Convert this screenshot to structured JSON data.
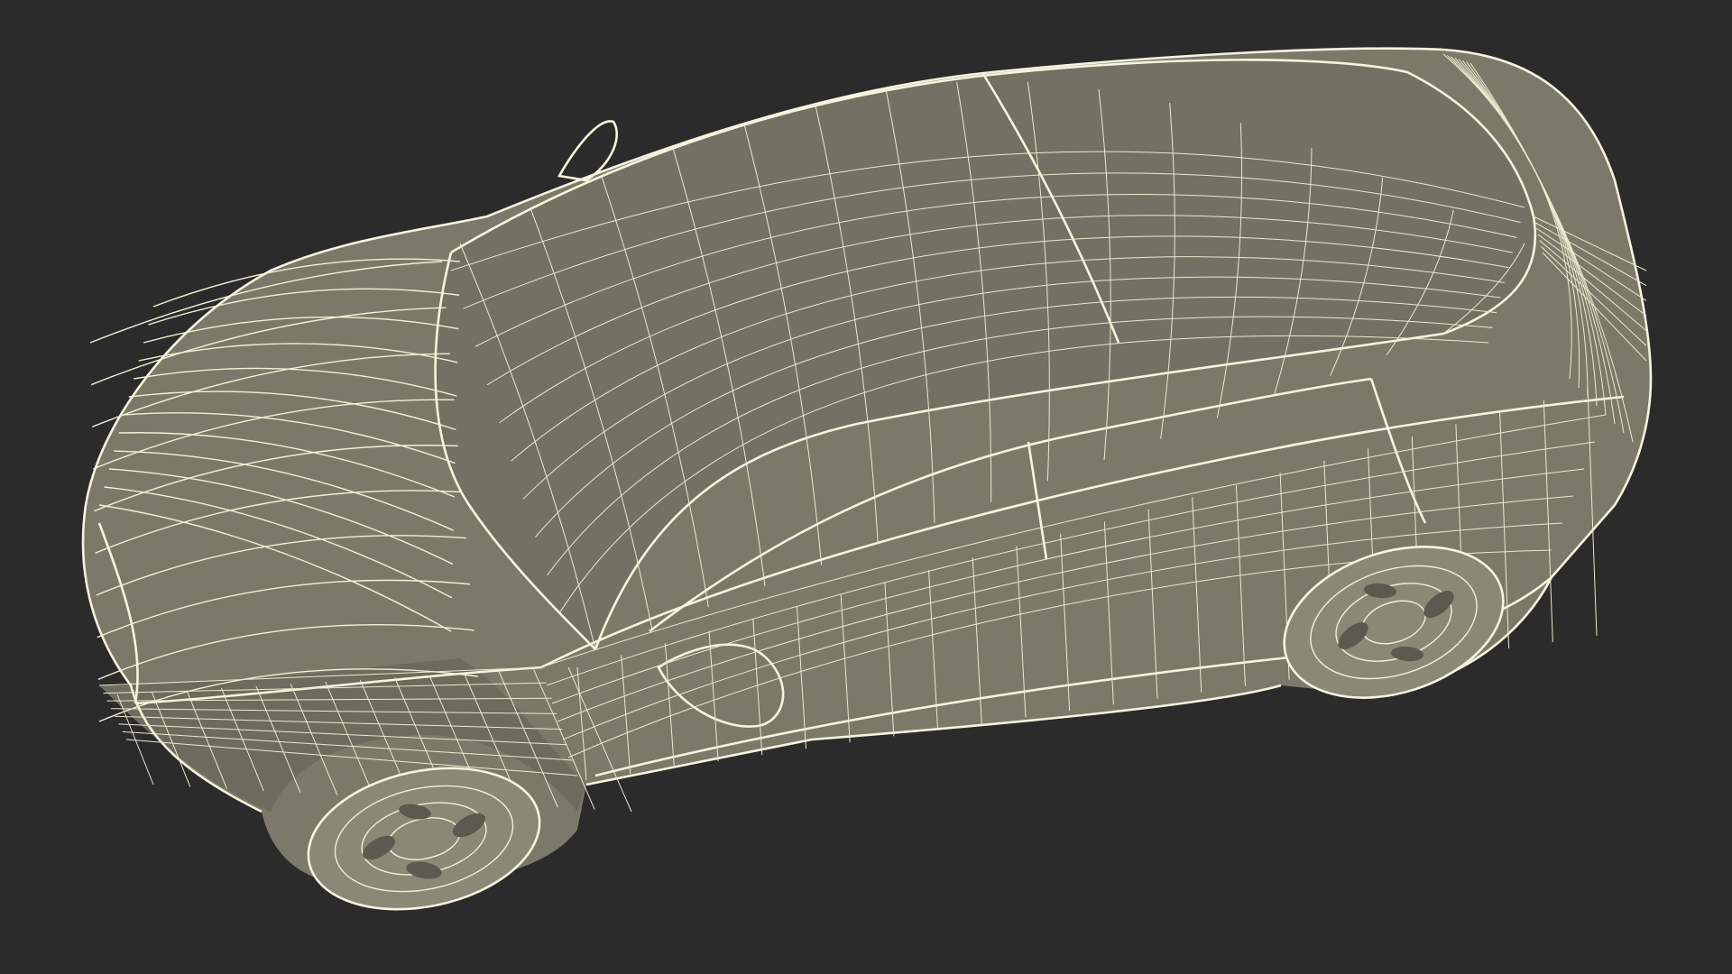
{
  "scene": {
    "subject": "car-wireframe",
    "view": "top-three-quarter",
    "background_color": "#2b2b2b",
    "body_color": "#7b7a6a",
    "wire_color": "#f2f0d6"
  }
}
